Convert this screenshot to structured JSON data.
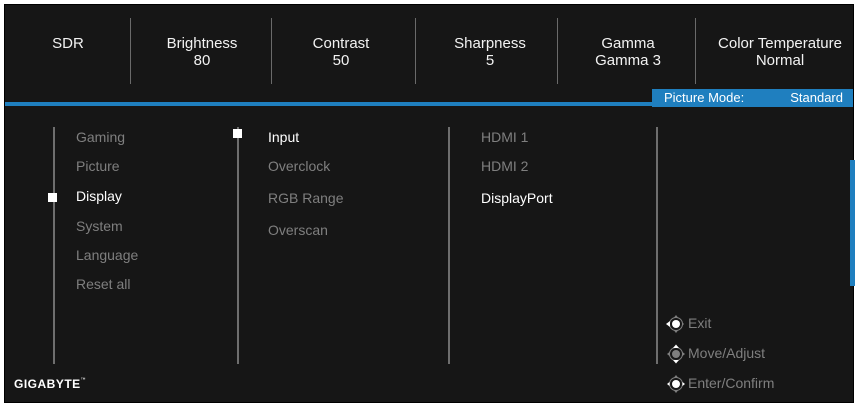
{
  "status_bar": [
    {
      "label": "SDR",
      "value": ""
    },
    {
      "label": "Brightness",
      "value": "80"
    },
    {
      "label": "Contrast",
      "value": "50"
    },
    {
      "label": "Sharpness",
      "value": "5"
    },
    {
      "label": "Gamma",
      "value": "Gamma 3"
    },
    {
      "label": "Color Temperature",
      "value": "Normal"
    }
  ],
  "picture_mode": {
    "label": "Picture Mode:",
    "value": "Standard"
  },
  "main_menu": {
    "items": [
      "Gaming",
      "Picture",
      "Display",
      "System",
      "Language",
      "Reset all"
    ],
    "selected": "Display"
  },
  "sub_menu": {
    "items": [
      "Input",
      "Overclock",
      "RGB Range",
      "Overscan"
    ],
    "selected": "Input"
  },
  "options": {
    "items": [
      "HDMI 1",
      "HDMI 2",
      "DisplayPort"
    ],
    "selected": "DisplayPort"
  },
  "hints": [
    {
      "icon": "joystick-left-icon",
      "label": "Exit"
    },
    {
      "icon": "joystick-updown-icon",
      "label": "Move/Adjust"
    },
    {
      "icon": "joystick-press-icon",
      "label": "Enter/Confirm"
    }
  ],
  "brand": {
    "logo_text": "GIGABYTE",
    "trademark": "™"
  },
  "colors": {
    "accent": "#1f7fbf",
    "background": "#161616",
    "active_text": "#ffffff",
    "inactive_text": "#7f7f7f"
  }
}
